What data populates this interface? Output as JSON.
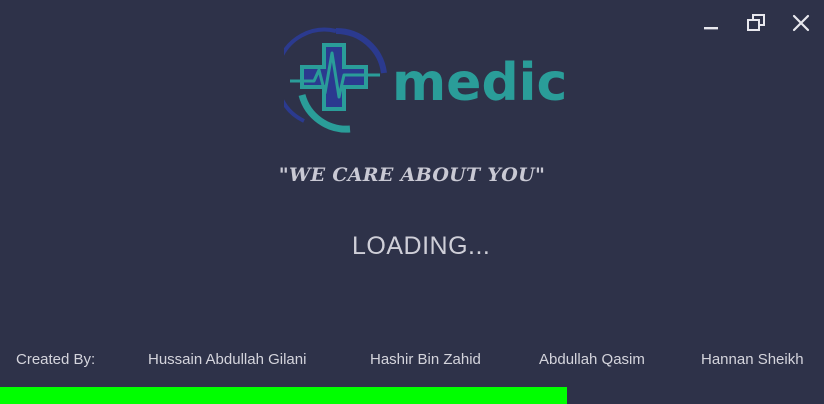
{
  "app": {
    "brand": "medic",
    "tagline": "\"WE CARE ABOUT YOU\"",
    "status_text": "LOADING..."
  },
  "window_controls": {
    "minimize_icon": "minimize-icon",
    "restore_icon": "restore-icon",
    "close_icon": "close-icon"
  },
  "credits": {
    "label": "Created By:",
    "authors": [
      "Hussain Abdullah Gilani",
      "Hashir Bin Zahid",
      "Abdullah Qasim",
      "Hannan Sheikh"
    ]
  },
  "progress": {
    "fraction": 0.688
  },
  "colors": {
    "background": "#2e3249",
    "brand_teal": "#2a9d99",
    "brand_blue": "#2b3a8f",
    "progress": "#00ff00",
    "text": "#d4d4dc"
  }
}
